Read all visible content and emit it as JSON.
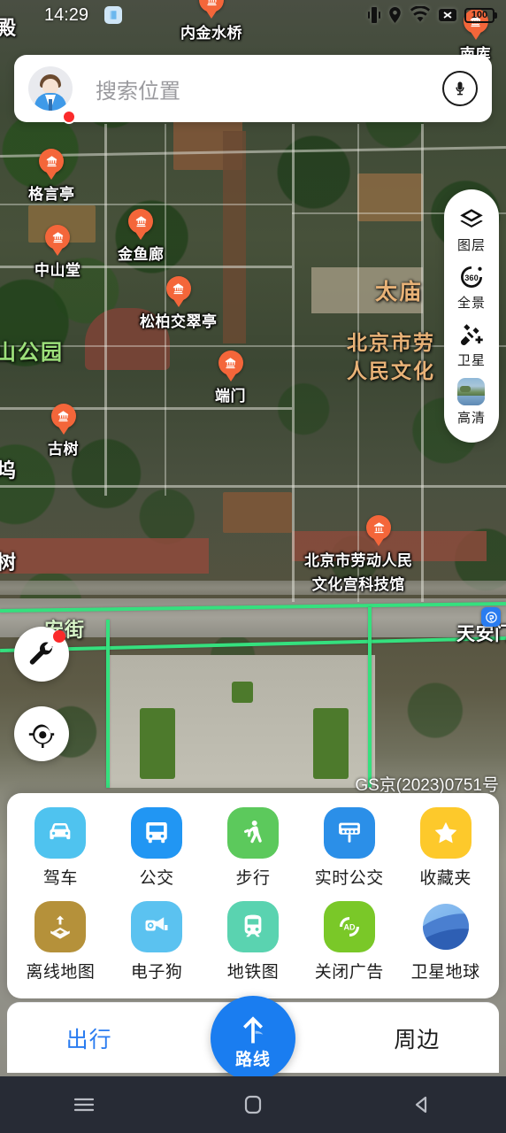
{
  "status_bar": {
    "time": "14:29",
    "battery_level": "100",
    "icons": [
      "app-icon",
      "vibrate-icon",
      "location-icon",
      "wifi-icon",
      "signal-off-icon",
      "battery-icon"
    ]
  },
  "search": {
    "placeholder": "搜索位置",
    "avatar_name": "user-avatar",
    "mic_name": "voice-search-icon",
    "has_notification": true
  },
  "map": {
    "copyright": "GS京(2023)0751号",
    "pois": [
      {
        "label": "内金水桥",
        "icon": "landmark-icon"
      },
      {
        "label": "格言亭",
        "icon": "landmark-icon"
      },
      {
        "label": "中山堂",
        "icon": "landmark-icon"
      },
      {
        "label": "金鱼廊",
        "icon": "landmark-icon"
      },
      {
        "label": "松柏交翠亭",
        "icon": "landmark-icon"
      },
      {
        "label": "端门",
        "icon": "landmark-icon"
      },
      {
        "label": "古树",
        "icon": "landmark-icon"
      },
      {
        "label": "南库",
        "icon": "landmark-icon"
      },
      {
        "label": "北京市劳动人民文化宫科技馆",
        "icon": "museum-icon"
      }
    ],
    "poi_labels": {
      "neijinshuiqiao": "内金水桥",
      "geyanting": "格言亭",
      "zhongshantang": "中山堂",
      "jinyulang": "金鱼廊",
      "songbaijiaocuiting": "松柏交翠亭",
      "duanmen": "端门",
      "gushu": "古树",
      "nanku": "南库",
      "kejiguan_line1": "北京市劳动人民",
      "kejiguan_line2": "文化宫科技馆",
      "dian": "殿",
      "wu": "坞",
      "shu": "树",
      "tiananmen": "天安门"
    },
    "area_labels": {
      "taimiao": "太庙",
      "wenhuagong_line1": "北京市劳",
      "wenhuagong_line2": "人民文化"
    },
    "park_label": "山公园",
    "road_label": "安街"
  },
  "rail": {
    "items": [
      {
        "label": "图层",
        "icon": "layers-icon"
      },
      {
        "label": "全景",
        "icon": "panorama-360-icon"
      },
      {
        "label": "卫星",
        "icon": "satellite-icon"
      },
      {
        "label": "高清",
        "icon": "hd-thumbnail-icon"
      }
    ]
  },
  "left_buttons": [
    {
      "name": "tools-button",
      "icon": "wrench-icon",
      "badge": true
    },
    {
      "name": "locate-button",
      "icon": "crosshair-icon",
      "badge": false
    }
  ],
  "sheet": {
    "row1": [
      {
        "label": "驾车",
        "icon": "car-icon",
        "color": "#4fc3ef"
      },
      {
        "label": "公交",
        "icon": "bus-icon",
        "color": "#2196f3"
      },
      {
        "label": "步行",
        "icon": "walk-icon",
        "color": "#5cc95c"
      },
      {
        "label": "实时公交",
        "icon": "bus-stop-icon",
        "color": "#2b8fe8"
      },
      {
        "label": "收藏夹",
        "icon": "star-icon",
        "color": "#fdc92b"
      }
    ],
    "row2": [
      {
        "label": "离线地图",
        "icon": "download-map-icon",
        "color": "#b5913a"
      },
      {
        "label": "电子狗",
        "icon": "speed-camera-icon",
        "color": "#5bc2f0"
      },
      {
        "label": "地铁图",
        "icon": "subway-icon",
        "color": "#5ad3b0"
      },
      {
        "label": "关闭广告",
        "icon": "close-ad-icon",
        "color": "#7ac828"
      },
      {
        "label": "卫星地球",
        "icon": "globe-icon",
        "color": "#4a7fd0"
      }
    ]
  },
  "tabbar": {
    "left_tab": "出行",
    "right_tab": "周边",
    "fab_label": "路线",
    "fab_icon": "route-arrow-icon",
    "active_color": "#2a7cf0"
  },
  "android_nav": {
    "recents": "recents-icon",
    "home": "home-icon",
    "back": "back-icon"
  }
}
